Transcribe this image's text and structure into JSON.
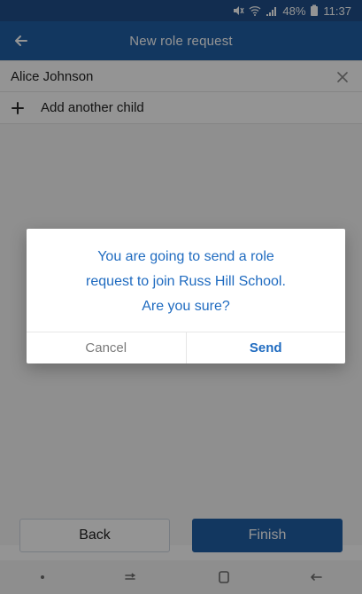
{
  "status_bar": {
    "battery_text": "48%",
    "time": "11:37",
    "icons": [
      "mute-icon",
      "wifi-icon",
      "signal-icon",
      "battery-icon"
    ]
  },
  "app_bar": {
    "title": "New role request",
    "back_icon": "back-arrow-icon"
  },
  "children": [
    {
      "name": "Alice Johnson",
      "remove_icon": "close-icon"
    }
  ],
  "add_child": {
    "label": "Add another child",
    "icon": "plus-icon"
  },
  "dialog": {
    "line1": "You are going to send a role",
    "line2": "request to join Russ Hill School.",
    "line3": "Are you sure?",
    "cancel_label": "Cancel",
    "send_label": "Send"
  },
  "actions": {
    "back_label": "Back",
    "finish_label": "Finish"
  },
  "nav_bar": {
    "icons": [
      "dot-icon",
      "recent-apps-icon",
      "home-icon",
      "back-icon"
    ]
  },
  "colors": {
    "primary": "#1f5fa6",
    "dialog_text": "#1f6bc0",
    "status_bar": "#1f4f8a"
  }
}
